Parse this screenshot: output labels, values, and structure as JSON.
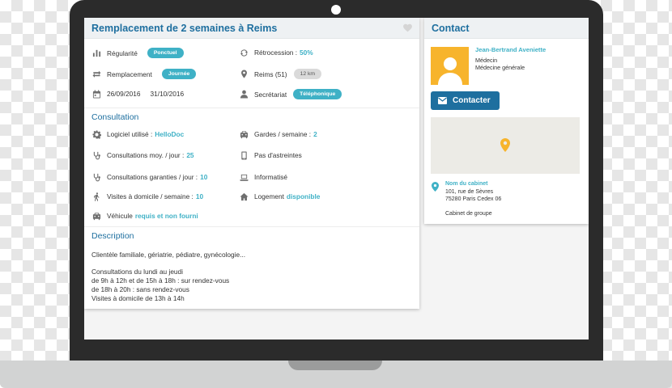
{
  "colors": {
    "accent": "#3fb1c6",
    "title_blue": "#1e6f9f",
    "avatar_bg": "#f7b42c"
  },
  "main": {
    "title": "Remplacement de 2 semaines à Reims",
    "regularite_label": "Régularité",
    "regularite_value": "Ponctuel",
    "retrocession_label": "Rétrocession :",
    "retrocession_value": "50%",
    "remplacement_label": "Remplacement",
    "remplacement_value": "Journée",
    "location_label": "Reims (51)",
    "location_distance": "12 km",
    "date_start": "26/09/2016",
    "date_end": "31/10/2016",
    "secretariat_label": "Secrétariat",
    "secretariat_value": "Téléphonique",
    "consultation_title": "Consultation",
    "logiciel_label": "Logiciel utilisé :",
    "logiciel_value": "HelloDoc",
    "gardes_label": "Gardes / semaine :",
    "gardes_value": "2",
    "consult_moy_label": "Consultations moy. / jour :",
    "consult_moy_value": "25",
    "astreintes_label": "Pas d'astreintes",
    "consult_garanties_label": "Consultations garanties / jour :",
    "consult_garanties_value": "10",
    "informatise_label": "Informatisé",
    "visites_label": "Visites à domicile / semaine :",
    "visites_value": "10",
    "logement_label": "Logement",
    "logement_value": "disponible",
    "vehicule_label": "Véhicule",
    "vehicule_value": "requis et non fourni",
    "description_title": "Description",
    "description_line1": "Clientèle familiale, gériatrie, pédiatre, gynécologie...",
    "description_line2": "Consultations du lundi au jeudi",
    "description_line3": "de 9h à 12h et de 15h à 18h : sur rendez-vous",
    "description_line4": "de 18h à 20h : sans rendez-vous",
    "description_line5": "Visites à domicile de 13h à 14h"
  },
  "contact": {
    "title": "Contact",
    "name": "Jean-Bertrand Aveniette",
    "role": "Médecin",
    "specialty": "Médecine générale",
    "button_label": "Contacter",
    "cabinet_name": "Nom du cabinet",
    "address_line1": "101, rue de Sèvres",
    "address_line2": "75280 Paris Cedex 06",
    "cabinet_type": "Cabinet de groupe"
  },
  "icons": [
    "heart-icon",
    "bar-chart-icon",
    "refresh-icon",
    "swap-icon",
    "pin-icon",
    "calendar-icon",
    "person-icon",
    "gear-icon",
    "car-icon",
    "stethoscope-icon",
    "phone-icon",
    "laptop-icon",
    "walk-icon",
    "home-icon",
    "mail-icon",
    "map-pin-icon"
  ]
}
